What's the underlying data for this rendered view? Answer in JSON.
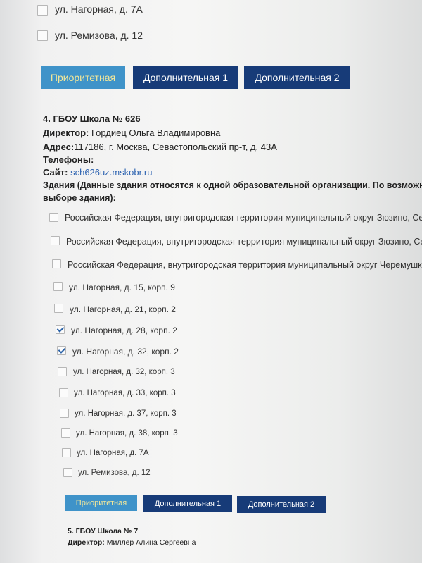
{
  "top_list": [
    {
      "label": "ул. Нагорная, д. 7А",
      "checked": false
    },
    {
      "label": "ул. Ремизова, д. 12",
      "checked": false
    }
  ],
  "buttons": {
    "priority": "Приоритетная",
    "extra1": "Дополнительная 1",
    "extra2": "Дополнительная 2"
  },
  "school": {
    "title": "4. ГБОУ Школа № 626",
    "director_label": "Директор:",
    "director": "Гордиец Ольга Владимировна",
    "address_label": "Адрес:",
    "address": "117186, г. Москва, Севастопольский пр-т, д. 43А",
    "phones_label": "Телефоны:",
    "site_label": "Сайт:",
    "site": "sch626uz.mskobr.ru",
    "buildings_line1": "Здания (Данные здания относятся к одной образовательной организации. По возможн",
    "buildings_line2": "выборе здания):",
    "buildings": [
      {
        "label": "Российская Федерация, внутригородская территория муниципальный округ Зюзино, Сева",
        "checked": false
      },
      {
        "label": "Российская Федерация, внутригородская территория муниципальный округ Зюзино, Сева",
        "checked": false
      },
      {
        "label": "Российская Федерация, внутригородская территория муниципальный округ Черемушки, Н",
        "checked": false
      },
      {
        "label": "ул. Нагорная, д. 15, корп. 9",
        "checked": false
      },
      {
        "label": "ул. Нагорная, д. 21, корп. 2",
        "checked": false
      },
      {
        "label": "ул. Нагорная, д. 28, корп. 2",
        "checked": true
      },
      {
        "label": "ул. Нагорная, д. 32, корп. 2",
        "checked": true
      },
      {
        "label": "ул. Нагорная, д. 32, корп. 3",
        "checked": false
      },
      {
        "label": "ул. Нагорная, д. 33, корп. 3",
        "checked": false
      },
      {
        "label": "ул. Нагорная, д. 37, корп. 3",
        "checked": false
      },
      {
        "label": "ул. Нагорная, д. 38, корп. 3",
        "checked": false
      },
      {
        "label": "ул. Нагорная, д. 7А",
        "checked": false
      },
      {
        "label": "ул. Ремизова, д. 12",
        "checked": false
      }
    ]
  },
  "next_school": {
    "title": "5. ГБОУ Школа № 7",
    "director_label": "Директор:",
    "director": "Миллер Алина Сергеевна"
  },
  "colors": {
    "primary_button": "#3f93c9",
    "primary_text": "#f2e79a",
    "navy_button": "#173b78",
    "link": "#3166b2",
    "check": "#2c63a8"
  }
}
